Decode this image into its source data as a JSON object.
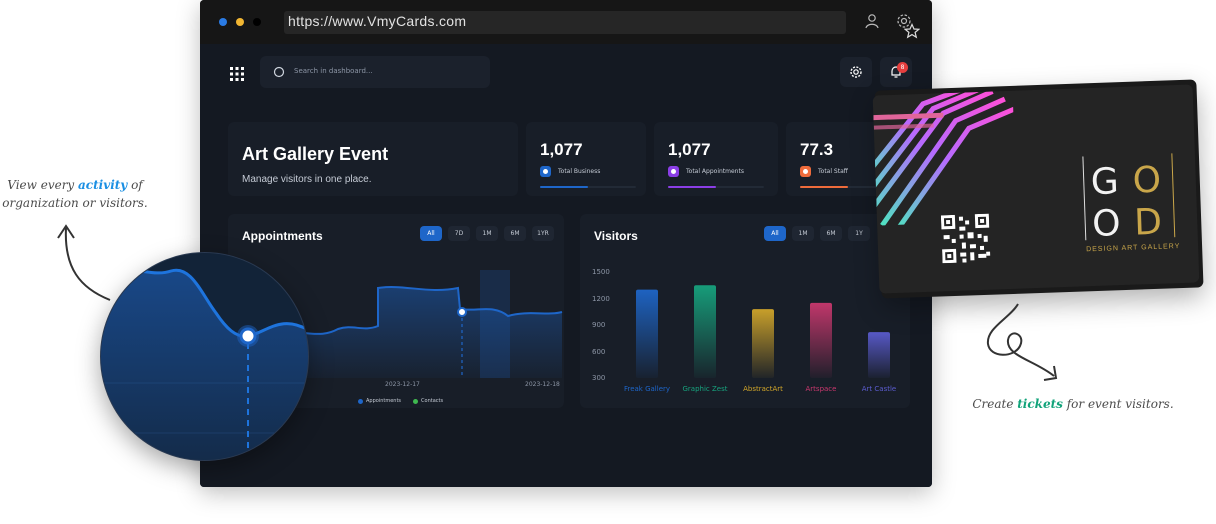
{
  "annotations": {
    "left": {
      "line1_pre": "View every ",
      "line1_em": "activity",
      "line1_post": " of",
      "line2": "organization or visitors."
    },
    "right": {
      "pre": "Create ",
      "em": "tickets",
      "post": " for event visitors."
    }
  },
  "browser": {
    "url": "https://www.VmyCards.com",
    "icons": [
      "star-icon",
      "user-icon",
      "gear-icon"
    ]
  },
  "header": {
    "search_placeholder": "Search in dashboard...",
    "notification_count": "8"
  },
  "event": {
    "title": "Art Gallery Event",
    "subtitle": "Manage visitors in one place."
  },
  "stats": [
    {
      "value": "1,077",
      "label": "Total Business",
      "color": "#1e66c9",
      "progress": 0.5
    },
    {
      "value": "1,077",
      "label": "Total Appointments",
      "color": "#8b3ee6",
      "progress": 0.5
    },
    {
      "value": "77.3",
      "label": "Total Staff",
      "color": "#ee6b3b",
      "progress": 0.5
    }
  ],
  "appointments": {
    "title": "Appointments",
    "ranges": [
      "All",
      "7D",
      "1M",
      "6M",
      "1YR"
    ],
    "active_range": "All",
    "dates": [
      "2023-12-17",
      "2023-12-18"
    ],
    "legend": [
      {
        "label": "Appointments",
        "color": "#1e66c9"
      },
      {
        "label": "Contacts",
        "color": "#3fb950"
      }
    ]
  },
  "visitors": {
    "title": "Visitors",
    "ranges": [
      "All",
      "1M",
      "6M",
      "1Y"
    ],
    "active_range": "All"
  },
  "chart_data": {
    "type": "bar",
    "title": "Visitors",
    "categories": [
      "Freak Gallery",
      "Graphic Zest",
      "AbstractArt",
      "Artspace",
      "Art Castle"
    ],
    "values": [
      1300,
      1350,
      1080,
      1150,
      820
    ],
    "colors": [
      "#1e66c9",
      "#17a37e",
      "#d1a62a",
      "#c9386e",
      "#5b5ccf"
    ],
    "yticks": [
      1500,
      1200,
      900,
      600,
      300
    ],
    "ylim": [
      300,
      1500
    ]
  },
  "ticket": {
    "logo_letters": [
      "G",
      "O",
      "O",
      "D"
    ],
    "subtitle": "DESIGN  ART GALLERY",
    "accent": "#c9a64a"
  }
}
